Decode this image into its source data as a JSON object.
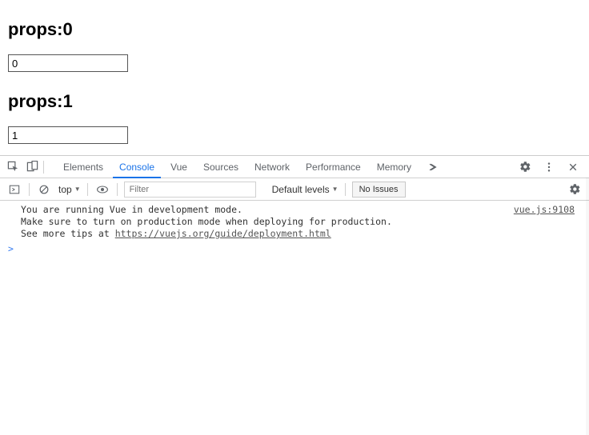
{
  "page": {
    "heading1": "props:0",
    "input1_value": "0",
    "heading2": "props:1",
    "input2_value": "1"
  },
  "devtools": {
    "tabs": {
      "elements": "Elements",
      "console": "Console",
      "vue": "Vue",
      "sources": "Sources",
      "network": "Network",
      "performance": "Performance",
      "memory": "Memory"
    },
    "toolbar": {
      "context": "top",
      "filter_placeholder": "Filter",
      "levels": "Default levels",
      "issues": "No Issues"
    },
    "message": {
      "line1": "You are running Vue in development mode.",
      "line2": "Make sure to turn on production mode when deploying for production.",
      "line3_prefix": "See more tips at ",
      "line3_link": "https://vuejs.org/guide/deployment.html",
      "source": "vue.js:9108"
    },
    "prompt": ">"
  }
}
